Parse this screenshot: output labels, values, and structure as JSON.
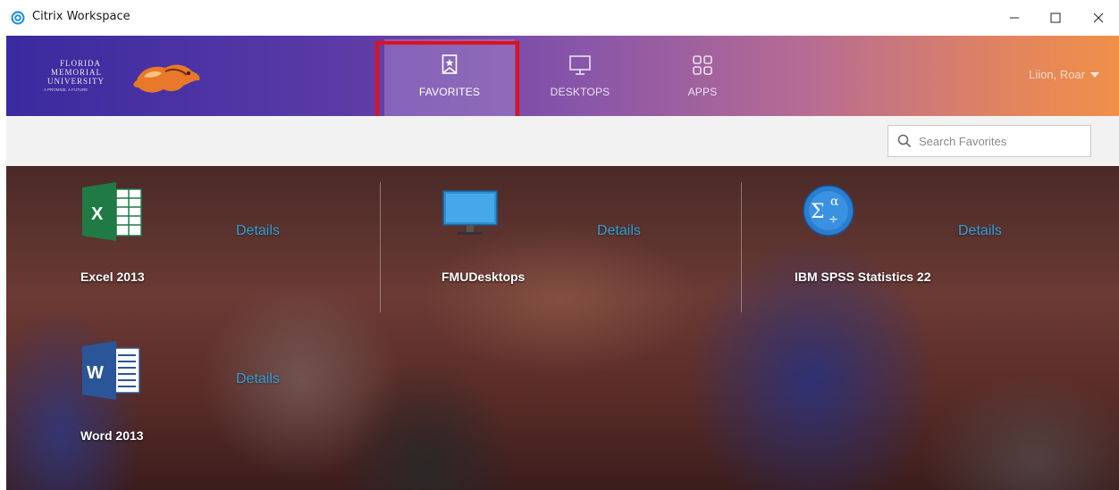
{
  "window": {
    "title": "Citrix Workspace",
    "controls": {
      "minimize": "minimize-icon",
      "maximize": "maximize-icon",
      "close": "close-icon"
    }
  },
  "header": {
    "logo_lines": [
      "FLORIDA",
      "MEMORIAL",
      "UNIVERSITY",
      "A PROMISE. A FUTURE"
    ],
    "tabs": [
      {
        "label": "FAVORITES",
        "icon": "favorites-bookmark-icon",
        "selected": true
      },
      {
        "label": "DESKTOPS",
        "icon": "desktop-monitor-icon",
        "selected": false
      },
      {
        "label": "APPS",
        "icon": "apps-grid-icon",
        "selected": false
      }
    ],
    "user": "Liion, Roar"
  },
  "search": {
    "placeholder": "Search Favorites",
    "value": ""
  },
  "favorites": [
    {
      "name": "Excel 2013",
      "details_label": "Details",
      "icon": "excel-icon"
    },
    {
      "name": "FMUDesktops",
      "details_label": "Details",
      "icon": "desktop-monitor-icon"
    },
    {
      "name": "IBM SPSS Statistics 22",
      "details_label": "Details",
      "icon": "spss-icon"
    },
    {
      "name": "Word 2013",
      "details_label": "Details",
      "icon": "word-icon"
    }
  ],
  "colors": {
    "header_start": "#3a2a9f",
    "header_end": "#f09048",
    "details_link": "#2fa0d8",
    "highlight_box": "#e3101a",
    "selected_tab_bg": "#9a7cc6"
  }
}
